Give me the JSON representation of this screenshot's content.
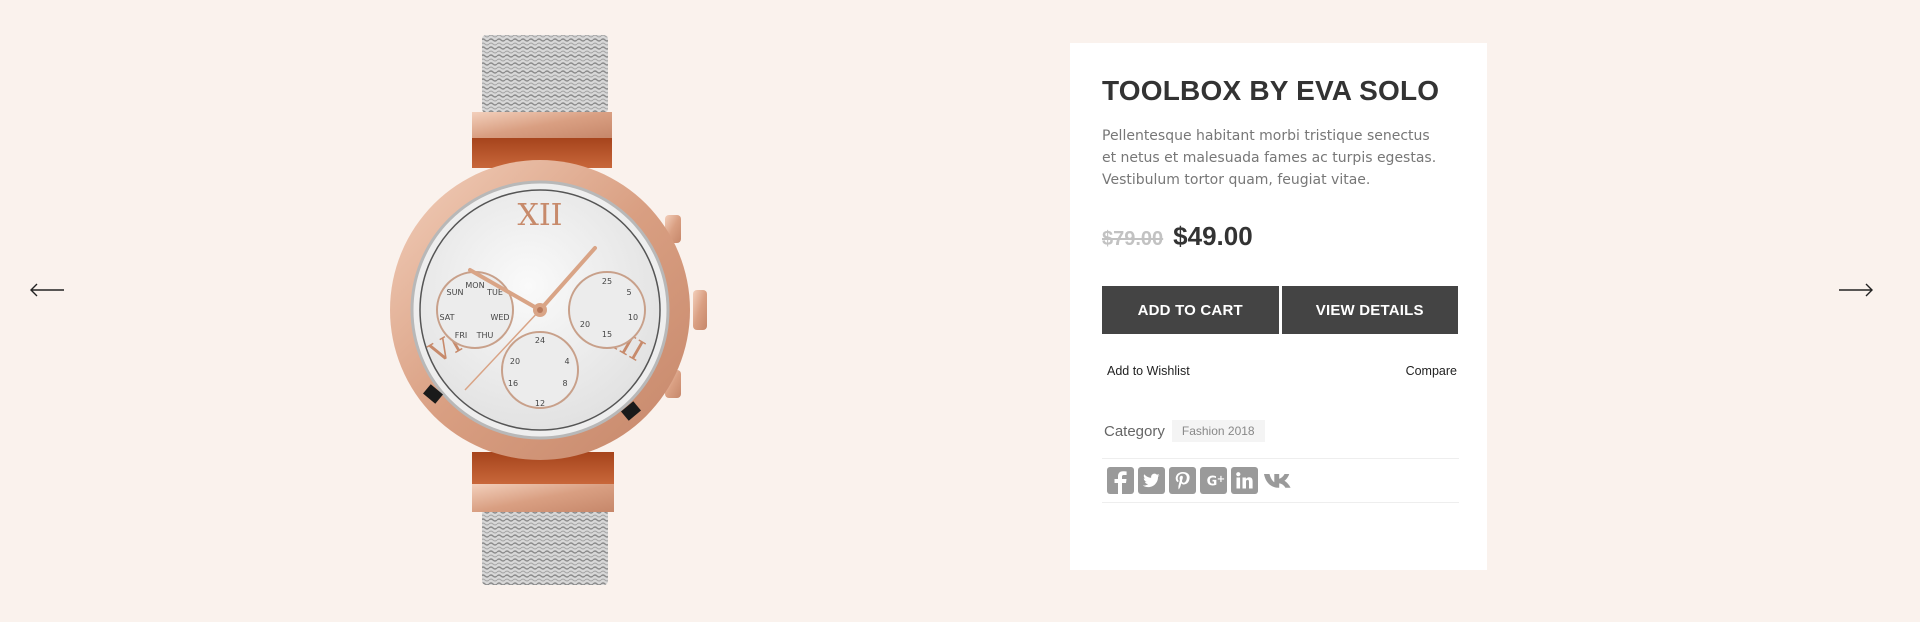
{
  "navigation": {
    "prev_icon": "arrow-left-icon",
    "next_icon": "arrow-right-icon"
  },
  "product": {
    "title": "TOOLBOX BY EVA SOLO",
    "description": "Pellentesque habitant morbi tristique senectus et netus et malesuada fames ac turpis egestas. Vestibulum tortor quam, feugiat vitae.",
    "old_price": "$79.00",
    "price": "$49.00",
    "image": "rose-gold-chronograph-watch"
  },
  "actions": {
    "add_to_cart": "ADD TO CART",
    "view_details": "VIEW DETAILS",
    "wishlist": "Add to Wishlist",
    "compare": "Compare"
  },
  "category": {
    "label": "Category",
    "value": "Fashion 2018"
  },
  "social": [
    "facebook-icon",
    "twitter-icon",
    "pinterest-icon",
    "google-plus-icon",
    "linkedin-icon",
    "vk-icon"
  ],
  "colors": {
    "background": "#faf2ed",
    "button": "#444444",
    "rose_gold": "#e8b9a0",
    "icon_gray": "#9a9a9a"
  }
}
